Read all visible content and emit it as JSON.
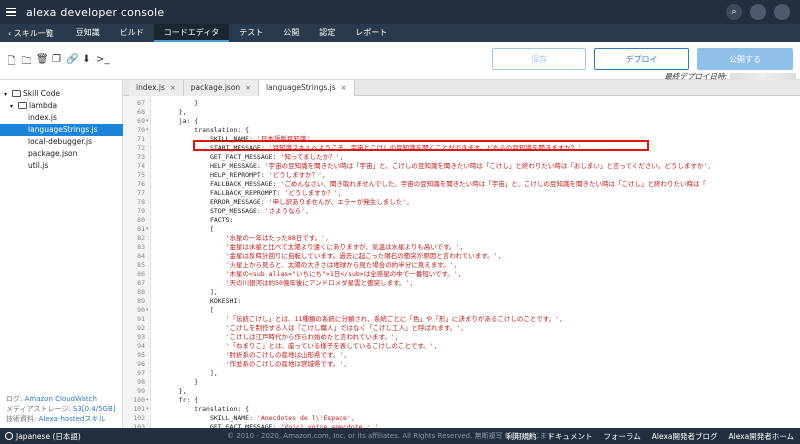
{
  "header": {
    "title": "alexa developer console"
  },
  "nav": {
    "back": "スキル一覧",
    "items": [
      "豆知識",
      "ビルド",
      "コードエディタ",
      "テスト",
      "公開",
      "認定",
      "レポート"
    ],
    "active": 2
  },
  "toolbar": {
    "icons": [
      "new-file-icon",
      "new-folder-icon",
      "delete-icon",
      "copy-icon",
      "link-icon",
      "download-icon",
      "terminal-icon"
    ],
    "save_label": "保存",
    "deploy_label": "デプロイ",
    "publish_label": "公開する",
    "last_deploy_label": "最終デプロイ日時:"
  },
  "sidebar": {
    "items": [
      {
        "label": "Skill Code",
        "type": "folder",
        "depth": 0
      },
      {
        "label": "lambda",
        "type": "folder",
        "depth": 1
      },
      {
        "label": "index.js",
        "type": "file",
        "depth": 2
      },
      {
        "label": "languageStrings.js",
        "type": "file",
        "depth": 2,
        "selected": true
      },
      {
        "label": "local-debugger.js",
        "type": "file",
        "depth": 2
      },
      {
        "label": "package.json",
        "type": "file",
        "depth": 2
      },
      {
        "label": "util.js",
        "type": "file",
        "depth": 2
      }
    ],
    "footer": {
      "log_label": "ログ: ",
      "log_link": "Amazon CloudWatch",
      "storage_label": "メディアストレージ: ",
      "storage_link": "S3[0.4/5GB]",
      "tech_label": "技術資料: ",
      "tech_link": "Alexa-hostedスキル"
    }
  },
  "tabs": [
    {
      "label": "index.js",
      "close": "×"
    },
    {
      "label": "package.json",
      "close": "×"
    },
    {
      "label": "languageStrings.js",
      "close": "×",
      "active": true
    }
  ],
  "editor": {
    "lines": [
      {
        "n": "67",
        "code": "        }"
      },
      {
        "n": "68",
        "code": "    },"
      },
      {
        "n": "69",
        "code": "    ja: {",
        "fold": true
      },
      {
        "n": "70",
        "code": "        translation: {",
        "fold": true
      },
      {
        "n": "71",
        "code": "            SKILL_NAME: '日本語版豆知識',",
        "str": true
      },
      {
        "n": "72",
        "code": "            START_MESSAGE: '豆知識スキルへようこそ。宇宙とこけしの豆知識を聞くことができます。どちらの豆知識を聞きますか？',",
        "str": true
      },
      {
        "n": "73",
        "code": "            GET_FACT_MESSAGE: '知ってましたか？',",
        "str": true
      },
      {
        "n": "74",
        "code": "            HELP_MESSAGE: '宇宙の豆知識を聞きたい時は「宇宙」と、こけしの豆知識を聞きたい時は「こけし」と終わりたい時は「おしまい」と言ってください。どうしますか',",
        "str": true
      },
      {
        "n": "75",
        "code": "            HELP_REPROMPT: 'どうしますか？',",
        "str": true
      },
      {
        "n": "76",
        "code": "            FALLBACK_MESSAGE: 'ごめんなさい、聞き取れませんでした。宇宙の豆知識を聞きたい時は「宇宙」と、こけしの豆知識を聞きたい時は「こけし」と終わりたい時は「",
        "str": true
      },
      {
        "n": "77",
        "code": "            FALLBACK_REPROMPT: 'どうしますか？',",
        "str": true
      },
      {
        "n": "78",
        "code": "            ERROR_MESSAGE: '申し訳ありませんが、エラーが発生しました',",
        "str": true
      },
      {
        "n": "79",
        "code": "            STOP_MESSAGE: 'さようなら',",
        "str": true
      },
      {
        "n": "80",
        "code": "            FACTS:"
      },
      {
        "n": "81",
        "code": "            [",
        "fold": true
      },
      {
        "n": "82",
        "code": "                '水星の一年はたった88日です。',",
        "str": true
      },
      {
        "n": "83",
        "code": "                '金星は水星と比べて太陽より遠くにありますが、気温は水星よりも高いです。',",
        "str": true
      },
      {
        "n": "84",
        "code": "                '金星は反時計回りに自転しています。過去に起こった隕石の衝突が原因と言われています。',",
        "str": true
      },
      {
        "n": "85",
        "code": "                '火星上から見ると、太陽の大きさは地球から見た場合の約半分に見えます。',",
        "str": true
      },
      {
        "n": "86",
        "code": "                '木星の<sub alias=\"いちにち\">1日</sub>は全惑星の中で一番短いです。',",
        "str": true
      },
      {
        "n": "87",
        "code": "                '天の川銀河は約50億年後にアンドロメダ星雲と衝突します。',",
        "str": true
      },
      {
        "n": "88",
        "code": "            ],"
      },
      {
        "n": "89",
        "code": "            KOKESHI:"
      },
      {
        "n": "90",
        "code": "            [",
        "fold": true
      },
      {
        "n": "91",
        "code": "                '「伝統こけし」とは、11種類の系統に分類され、系統ごとに「色」や「形」に決まりがあるこけしのことです。',",
        "str": true
      },
      {
        "n": "92",
        "code": "                'こけしを制作する人は「こけし職人」ではなく「こけし工人」と呼ばれます。',",
        "str": true
      },
      {
        "n": "93",
        "code": "                'こけしは江戸時代から作られ始めたと言われています。',",
        "str": true
      },
      {
        "n": "94",
        "code": "                '「ねまりこ」とは、座っている様子を表しているこけしのことです。',",
        "str": true
      },
      {
        "n": "95",
        "code": "                '肘折系のこけしの産地は山形県です。',",
        "str": true
      },
      {
        "n": "96",
        "code": "                '作並系のこけしの産地は宮城県です。',",
        "str": true
      },
      {
        "n": "97",
        "code": "            ],"
      },
      {
        "n": "98",
        "code": "        }"
      },
      {
        "n": "99",
        "code": "    },"
      },
      {
        "n": "100",
        "code": "    fr: {",
        "fold": true
      },
      {
        "n": "101",
        "code": "        translation: {",
        "fold": true
      },
      {
        "n": "102",
        "code": "            SKILL_NAME: 'Anecdotes de l\\'Espace',",
        "str": true
      },
      {
        "n": "103",
        "code": "            GET_FACT_MESSAGE: 'Voici votre anecdote : ',",
        "str": true
      }
    ]
  },
  "footer": {
    "language": "Japanese (日本語)",
    "copyright": "© 2010 - 2020, Amazon.com, Inc. or its affiliates. All Rights Reserved. 無断複写 転載を禁じます",
    "links": [
      "利用規約",
      "ドキュメント",
      "フォーラム",
      "Alexa開発者ブログ",
      "Alexa開発者ホーム"
    ]
  }
}
